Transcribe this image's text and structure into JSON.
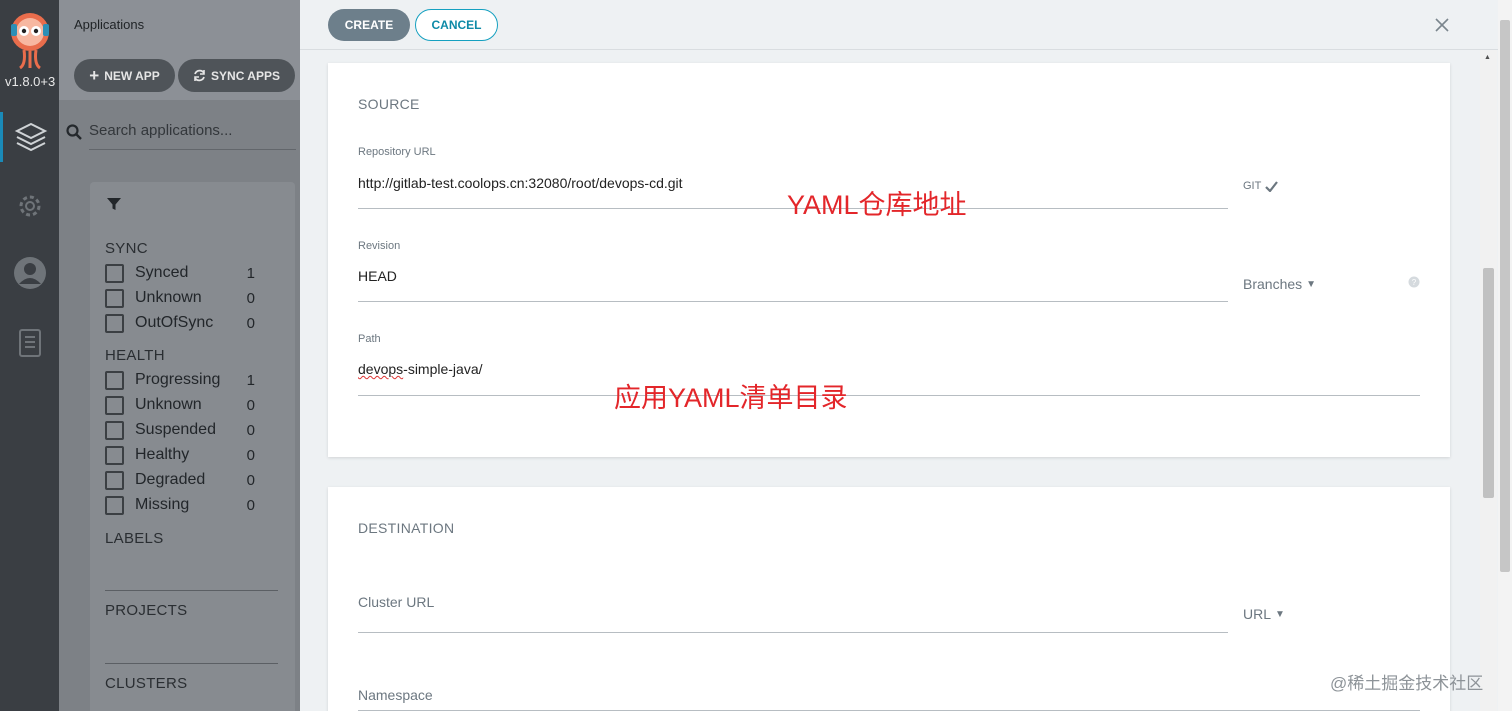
{
  "app": {
    "version": "v1.8.0+3"
  },
  "sidebar": {
    "title": "Applications",
    "new_app_label": "NEW APP",
    "sync_apps_label": "SYNC APPS",
    "search_placeholder": "Search applications...",
    "sync_title": "SYNC",
    "sync_items": [
      {
        "label": "Synced",
        "count": "1"
      },
      {
        "label": "Unknown",
        "count": "0"
      },
      {
        "label": "OutOfSync",
        "count": "0"
      }
    ],
    "health_title": "HEALTH",
    "health_items": [
      {
        "label": "Progressing",
        "count": "1"
      },
      {
        "label": "Unknown",
        "count": "0"
      },
      {
        "label": "Suspended",
        "count": "0"
      },
      {
        "label": "Healthy",
        "count": "0"
      },
      {
        "label": "Degraded",
        "count": "0"
      },
      {
        "label": "Missing",
        "count": "0"
      }
    ],
    "labels_title": "LABELS",
    "projects_title": "PROJECTS",
    "clusters_title": "CLUSTERS"
  },
  "toolbar": {
    "create_label": "CREATE",
    "cancel_label": "CANCEL"
  },
  "source": {
    "title": "SOURCE",
    "repo_url_label": "Repository URL",
    "repo_url_value": "http://gitlab-test.coolops.cn:32080/root/devops-cd.git",
    "repo_type": "GIT",
    "revision_label": "Revision",
    "revision_value": "HEAD",
    "revision_selector": "Branches",
    "path_label": "Path",
    "path_value_prefix": "devops",
    "path_value_rest": "-simple-java/"
  },
  "destination": {
    "title": "DESTINATION",
    "cluster_url_label": "Cluster URL",
    "cluster_selector": "URL",
    "namespace_label": "Namespace"
  },
  "annotations": {
    "repo_note": "YAML仓库地址",
    "path_note": "应用YAML清单目录"
  },
  "watermark": "@稀土掘金技术社区",
  "colors": {
    "accent": "#15a0c0",
    "annotation": "#e3262a",
    "nav_bg": "#3a3e43"
  }
}
